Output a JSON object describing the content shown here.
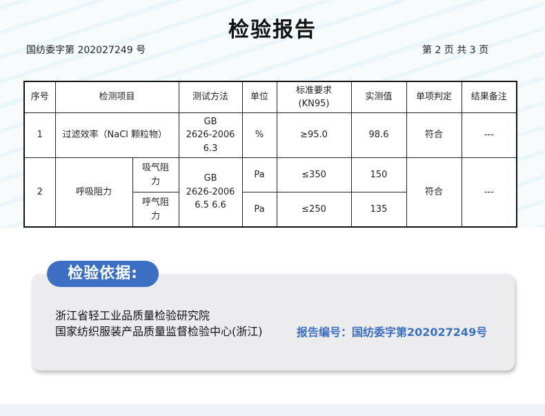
{
  "report": {
    "title": "检验报告",
    "report_number_label": "国纺委字第 202027249 号",
    "page_label": "第 2 页  共 3 页"
  },
  "table": {
    "headers": [
      "序号",
      "检测项目",
      "测试方法",
      "单位",
      "标准要求\n(KN95)",
      "实测值",
      "单项判定",
      "结果备注"
    ],
    "rows": [
      {
        "no": "1",
        "item": "过滤效率（NaCl 颗粒物）",
        "method": "GB\n2626-2006\n6.3",
        "unit": "%",
        "requirement": "≥95.0",
        "value": "98.6",
        "judgement": "符合",
        "remark": "---"
      },
      {
        "no": "2",
        "item": "呼吸阻力",
        "sub1": "吸气阻\n力",
        "sub2": "呼气阻\n力",
        "method": "GB\n2626-2006\n6.5 6.6",
        "unit1": "Pa",
        "unit2": "Pa",
        "req1": "≤350",
        "req2": "≤250",
        "value1": "150",
        "value2": "135",
        "judgement": "符合",
        "remark": "---"
      }
    ]
  },
  "basis": {
    "heading": "检验依据:",
    "org1": "浙江省轻工业品质量检验研究院",
    "org2": "国家纺织服装产品质量监督检验中心(浙江)",
    "report_ref": "报告编号：国纺委字第202027249号"
  }
}
